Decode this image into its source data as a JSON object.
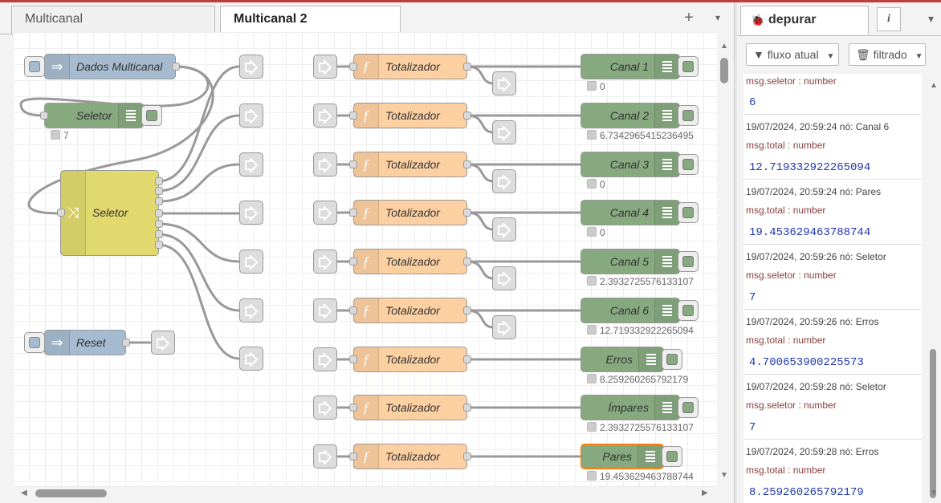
{
  "workspace": {
    "tabs": [
      {
        "label": "Multicanal",
        "active": false
      },
      {
        "label": "Multicanal 2",
        "active": true
      }
    ],
    "add_tab_icon": "+",
    "tab_menu_icon": "▾"
  },
  "flow": {
    "nodes": {
      "dados": {
        "label": "Dados Multicanal"
      },
      "seletor_debug": {
        "label": "Seletor",
        "status": "7"
      },
      "switch": {
        "label": "Seletor"
      },
      "reset": {
        "label": "Reset"
      },
      "func_label": "Totalizador",
      "outputs": [
        {
          "label": "Canal 1",
          "status": "0"
        },
        {
          "label": "Canal 2",
          "status": "6.7342965415236495"
        },
        {
          "label": "Canal 3",
          "status": "0"
        },
        {
          "label": "Canal 4",
          "status": "0"
        },
        {
          "label": "Canal 5",
          "status": "2.3932725576133107"
        },
        {
          "label": "Canal 6",
          "status": "12.719332922265094"
        },
        {
          "label": "Erros",
          "status": "8.259260265792179"
        },
        {
          "label": "Ímpares",
          "status": "2.3932725576133107"
        },
        {
          "label": "Pares",
          "status": "19.453629463788744"
        }
      ]
    }
  },
  "sidebar": {
    "tab_label": "depurar",
    "info_label": "i",
    "filter_current": "fluxo atual",
    "filter_filtered": "filtrado",
    "messages": [
      {
        "meta": "",
        "prop": "msg.seletor : number",
        "value": "6"
      },
      {
        "meta": "19/07/2024, 20:59:24   nó: Canal 6",
        "prop": "msg.total : number",
        "value": "12.719332922265094"
      },
      {
        "meta": "19/07/2024, 20:59:24   nó: Pares",
        "prop": "msg.total : number",
        "value": "19.453629463788744"
      },
      {
        "meta": "19/07/2024, 20:59:26   nó: Seletor",
        "prop": "msg.seletor : number",
        "value": "7"
      },
      {
        "meta": "19/07/2024, 20:59:26   nó: Erros",
        "prop": "msg.total : number",
        "value": "4.700653900225573"
      },
      {
        "meta": "19/07/2024, 20:59:28   nó: Seletor",
        "prop": "msg.seletor : number",
        "value": "7"
      },
      {
        "meta": "19/07/2024, 20:59:28   nó: Erros",
        "prop": "msg.total : number",
        "value": "8.259260265792179"
      }
    ]
  },
  "colors": {
    "inject": "#a6bbcf",
    "debug": "#87a980",
    "function": "#fdd0a2",
    "switch": "#e2d96e",
    "link": "#dddddd",
    "selected_border": "#ff7f0e"
  }
}
